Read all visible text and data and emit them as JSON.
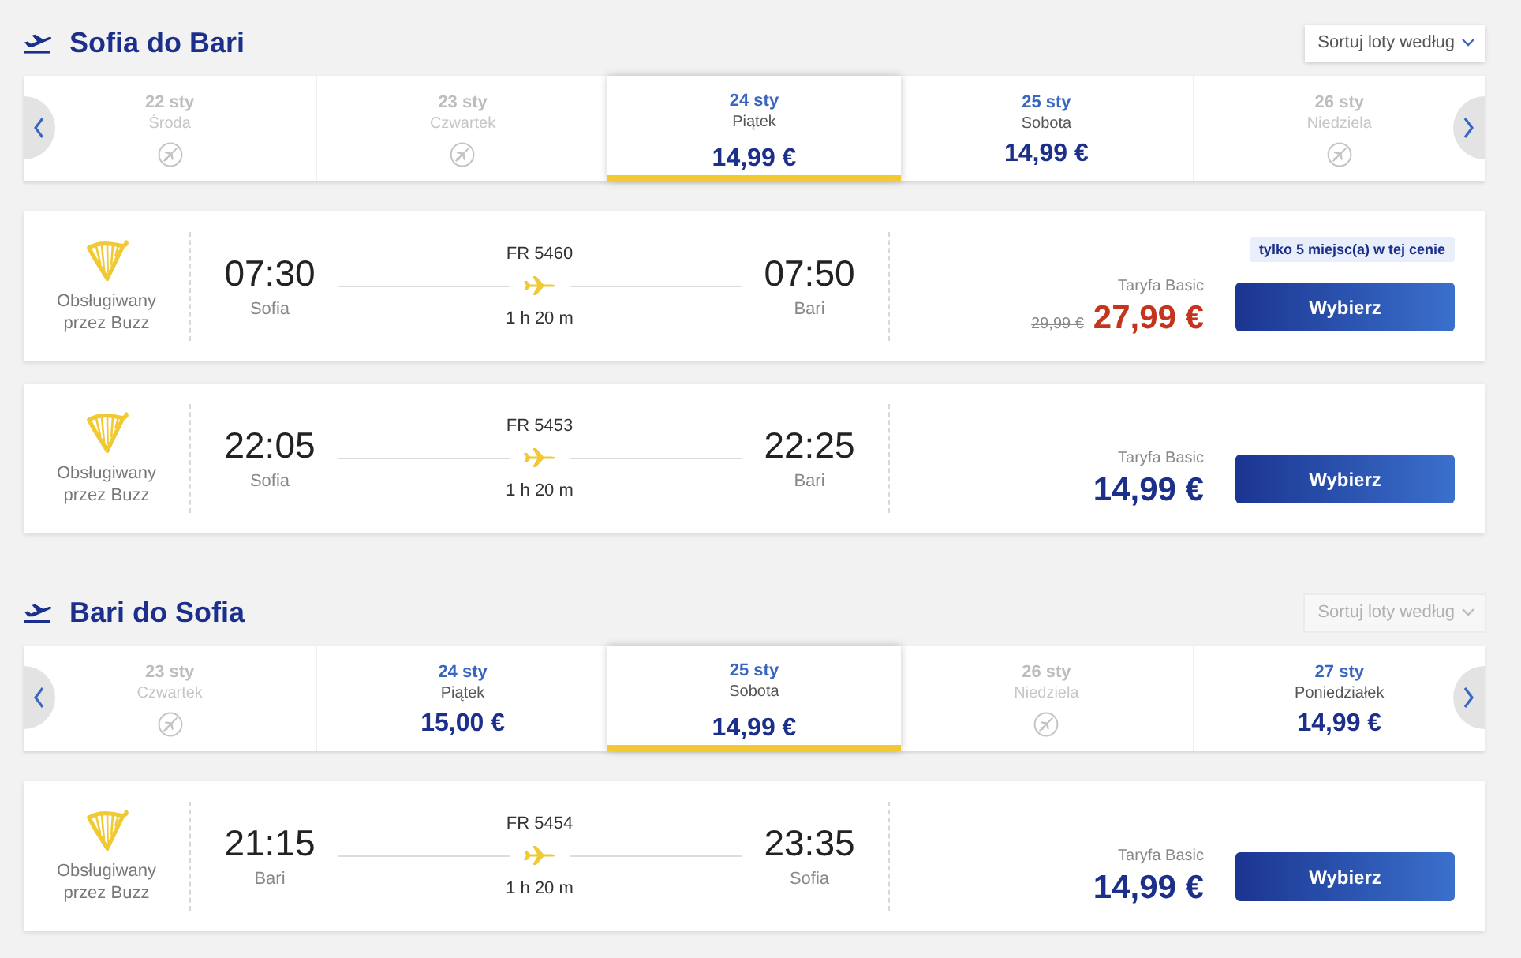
{
  "sections": [
    {
      "title": "Sofia do Bari",
      "sort": {
        "label": "Sortuj loty według",
        "disabled": false
      },
      "dates": [
        {
          "date": "22 sty",
          "day": "Środa",
          "available": false,
          "selected": false
        },
        {
          "date": "23 sty",
          "day": "Czwartek",
          "available": false,
          "selected": false
        },
        {
          "date": "24 sty",
          "day": "Piątek",
          "price": "14,99 €",
          "available": true,
          "selected": true
        },
        {
          "date": "25 sty",
          "day": "Sobota",
          "price": "14,99 €",
          "available": true,
          "selected": false
        },
        {
          "date": "26 sty",
          "day": "Niedziela",
          "available": false,
          "selected": false
        }
      ],
      "flights": [
        {
          "operator": "Obsługiwany przez Buzz",
          "departure_time": "07:30",
          "departure_city": "Sofia",
          "flight_number": "FR 5460",
          "duration": "1 h 20 m",
          "arrival_time": "07:50",
          "arrival_city": "Bari",
          "badge": "tylko 5 miejsc(a) w tej cenie",
          "fare": "Taryfa Basic",
          "old_price": "29,99 €",
          "price": "27,99 €",
          "button": "Wybierz"
        },
        {
          "operator": "Obsługiwany przez Buzz",
          "departure_time": "22:05",
          "departure_city": "Sofia",
          "flight_number": "FR 5453",
          "duration": "1 h 20 m",
          "arrival_time": "22:25",
          "arrival_city": "Bari",
          "fare": "Taryfa Basic",
          "price": "14,99 €",
          "button": "Wybierz"
        }
      ]
    },
    {
      "title": "Bari do Sofia",
      "sort": {
        "label": "Sortuj loty według",
        "disabled": true
      },
      "dates": [
        {
          "date": "23 sty",
          "day": "Czwartek",
          "available": false,
          "selected": false
        },
        {
          "date": "24 sty",
          "day": "Piątek",
          "price": "15,00 €",
          "available": true,
          "selected": false
        },
        {
          "date": "25 sty",
          "day": "Sobota",
          "price": "14,99 €",
          "available": true,
          "selected": true
        },
        {
          "date": "26 sty",
          "day": "Niedziela",
          "available": false,
          "selected": false
        },
        {
          "date": "27 sty",
          "day": "Poniedziałek",
          "price": "14,99 €",
          "available": true,
          "selected": false
        }
      ],
      "flights": [
        {
          "operator": "Obsługiwany przez Buzz",
          "departure_time": "21:15",
          "departure_city": "Bari",
          "flight_number": "FR 5454",
          "duration": "1 h 20 m",
          "arrival_time": "23:35",
          "arrival_city": "Sofia",
          "fare": "Taryfa Basic",
          "price": "14,99 €",
          "button": "Wybierz"
        }
      ]
    }
  ]
}
